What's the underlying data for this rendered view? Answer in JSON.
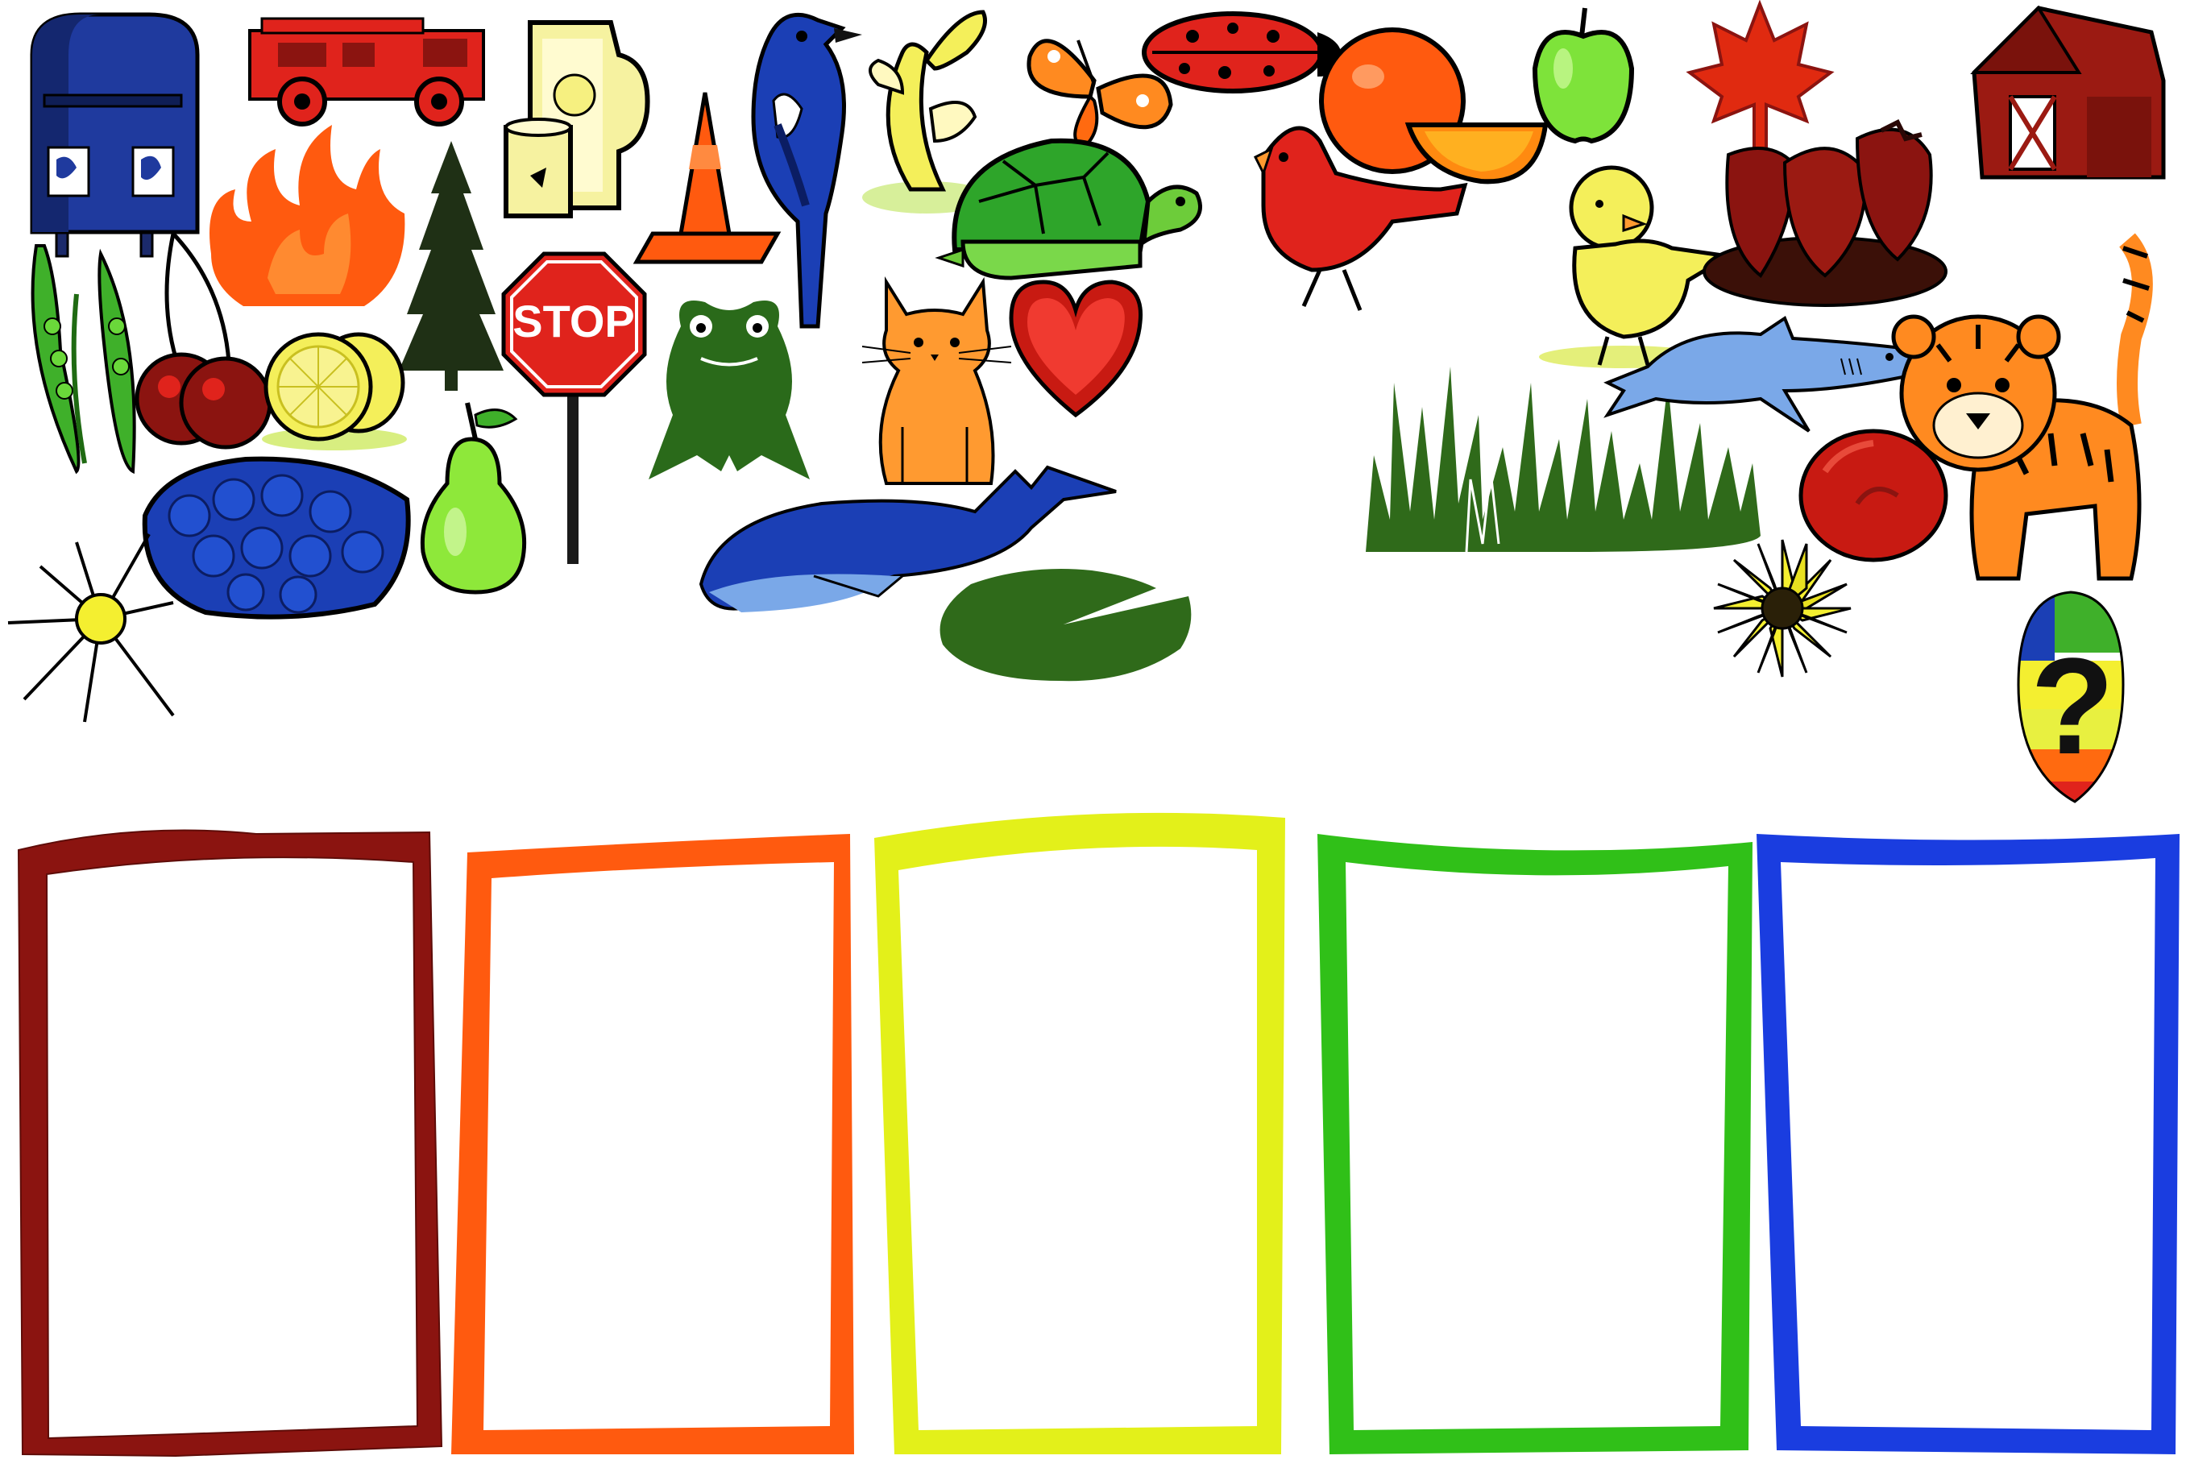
{
  "stop_sign": {
    "text": "STOP"
  },
  "mystery_egg": {
    "symbol": "?"
  },
  "bins": [
    {
      "color_name": "red",
      "color": "#8b1410"
    },
    {
      "color_name": "orange",
      "color": "#ff5a0f"
    },
    {
      "color_name": "yellow",
      "color": "#e3f01a"
    },
    {
      "color_name": "green",
      "color": "#30c018"
    },
    {
      "color_name": "blue",
      "color": "#1a3de0"
    }
  ],
  "palette": {
    "red": "#e0231c",
    "dark_red": "#8b1410",
    "orange": "#ff6a10",
    "yellow": "#f4ef5a",
    "green": "#3fb02a",
    "dark_green": "#1f4a12",
    "blue": "#1b3fb5",
    "light_blue": "#7aa8e8"
  },
  "items": [
    "mailbox-icon",
    "fire-truck-icon",
    "lemonade-pitcher-icon",
    "blue-jay-icon",
    "banana-icon",
    "butterfly-icon",
    "ladybug-icon",
    "orange-fruit-icon",
    "apple-icon",
    "maple-leaf-icon",
    "barn-icon",
    "flame-icon",
    "pine-tree-icon",
    "traffic-cone-icon",
    "turtle-icon",
    "cardinal-icon",
    "chick-icon",
    "strawberries-icon",
    "pea-pods-icon",
    "cherries-icon",
    "lemon-icon",
    "stop-sign-icon",
    "frog-icon",
    "cat-icon",
    "heart-icon",
    "grass-icon",
    "shark-icon",
    "tiger-icon",
    "blueberries-icon",
    "pear-icon",
    "whale-icon",
    "lily-pad-icon",
    "sun-icon",
    "tomato-icon",
    "sunflower-icon",
    "mystery-egg-icon"
  ]
}
